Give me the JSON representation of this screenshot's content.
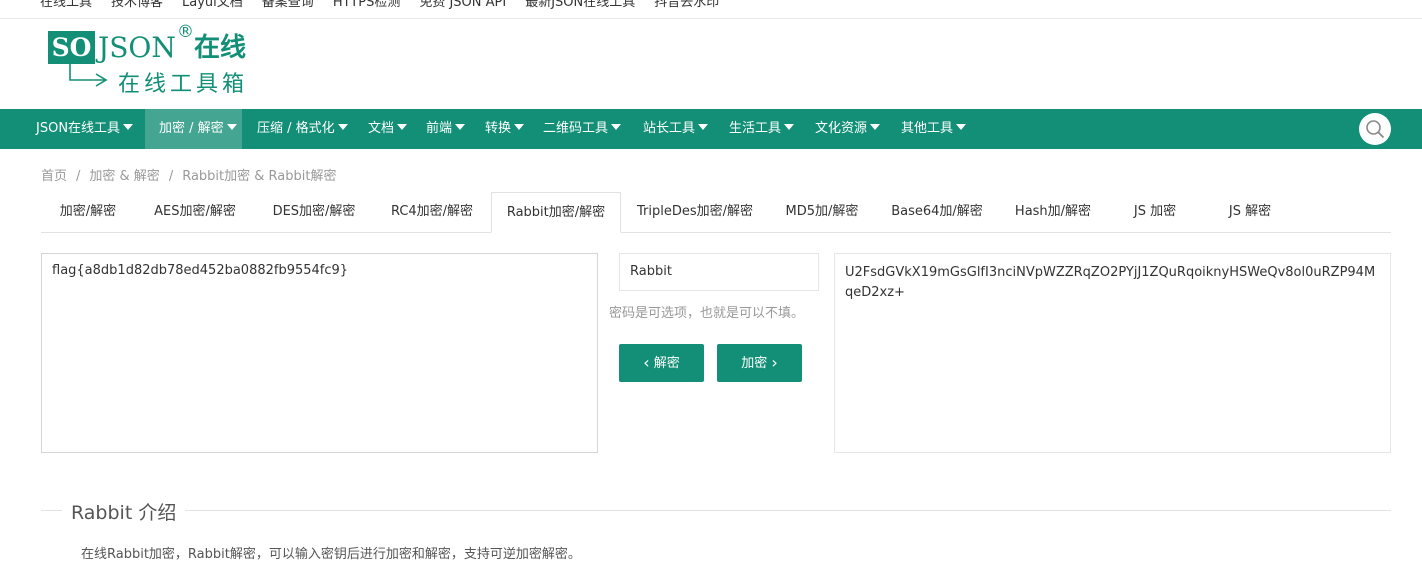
{
  "top_links": [
    "在线工具",
    "技术博客",
    "Layui文档",
    "备案查询",
    "HTTPS检测",
    "免费 JSON API",
    "最新JSON在线工具",
    "抖音去水印"
  ],
  "logo": {
    "so": "SO",
    "json": "JSON",
    "reg": "®",
    "zaixian": "在线",
    "tagline": "在线工具箱"
  },
  "nav": {
    "items": [
      {
        "label": "JSON在线工具"
      },
      {
        "label": "加密 / 解密"
      },
      {
        "label": "压缩 / 格式化"
      },
      {
        "label": "文档"
      },
      {
        "label": "前端"
      },
      {
        "label": "转换"
      },
      {
        "label": "二维码工具"
      },
      {
        "label": "站长工具"
      },
      {
        "label": "生活工具"
      },
      {
        "label": "文化资源"
      },
      {
        "label": "其他工具"
      }
    ],
    "active_index": 1,
    "search_icon": "search-icon",
    "accent": "#128f76"
  },
  "breadcrumb": [
    "首页",
    "加密 & 解密",
    "Rabbit加密 & Rabbit解密"
  ],
  "breadcrumb_sep": "/",
  "tabs": [
    {
      "label": "加密/解密"
    },
    {
      "label": "AES加密/解密"
    },
    {
      "label": "DES加密/解密"
    },
    {
      "label": "RC4加密/解密"
    },
    {
      "label": "Rabbit加密/解密"
    },
    {
      "label": "TripleDes加密/解密"
    },
    {
      "label": "MD5加/解密"
    },
    {
      "label": "Base64加/解密"
    },
    {
      "label": "Hash加/解密"
    },
    {
      "label": "JS 加密"
    },
    {
      "label": "JS 解密"
    }
  ],
  "active_tab": "Rabbit加密/解密",
  "input": {
    "value": "flag{a8db1d82db78ed452ba0882fb9554fc9}"
  },
  "key": {
    "value": "Rabbit",
    "hint": "密码是可选项，也就是可以不填。"
  },
  "buttons": {
    "decrypt": "解密",
    "encrypt": "加密"
  },
  "output": {
    "value": "U2FsdGVkX19mGsGlfI3nciNVpWZZRqZO2PYjJ1ZQuRqoiknyHSWeQv8ol0uRZP94MqeD2xz+"
  },
  "intro": {
    "title": "Rabbit 介绍",
    "text": "在线Rabbit加密，Rabbit解密，可以输入密钥后进行加密和解密，支持可逆加密解密。"
  }
}
